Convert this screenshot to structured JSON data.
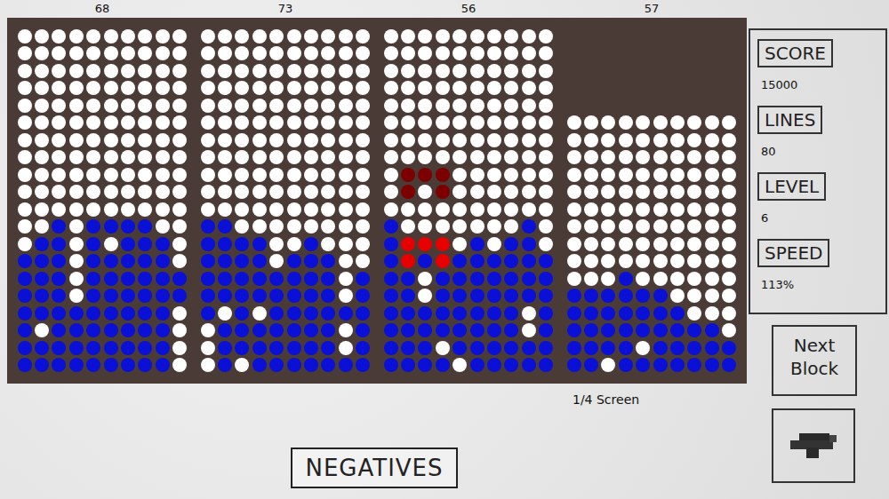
{
  "boards": [
    {
      "score": "68",
      "rows": [
        "wwwwwwwwww",
        "wwwwwwwwww",
        "wwwwwwwwww",
        "wwwwwwwwww",
        "wwwwwwwwww",
        "wwwwwwwwww",
        "wwwwwwwwww",
        "wwwwwwwwww",
        "wwwwwwwwww",
        "wwwwwwwwww",
        "wwwwwwwwww",
        "wwbwbbbbww",
        "wbbwbwbbbw",
        "bbbwbbbbbw",
        "bbbwbbbbbb",
        "bbbwbbbbbb",
        "bbbbbbbbbw",
        "bwbbbbbbbw",
        "bbbbbbbbbw",
        "bbbbbbbbbw"
      ]
    },
    {
      "score": "73",
      "rows": [
        "wwwwwwwwww",
        "wwwwwwwwww",
        "wwwwwwwwww",
        "wwwwwwwwww",
        "wwwwwwwwww",
        "wwwwwwwwww",
        "wwwwwwwwww",
        "wwwwwwwwww",
        "wwwwwwwwww",
        "wwwwwwwwww",
        "wwwwwwwwww",
        "bbwwwwwwww",
        "bbbbwwbwww",
        "bbbbwbbbww",
        "bbbbbbbbwb",
        "bbbbbbbbwb",
        "bwbwbbbbbb",
        "wbbbbbbbwb",
        "wbbbbbbbwb",
        "wbwbbbbbbb"
      ]
    },
    {
      "score": "56",
      "rows": [
        "wwwwwwwwww",
        "wwwwwwwwww",
        "wwwwwwwwww",
        "wwwwwwwwww",
        "wwwwwwwwww",
        "wwwwwwwwww",
        "wwwwwwwwww",
        "wwwwwwwwww",
        "wdddwwwwww",
        "wdwdwwwwww",
        "wwwwwwwwww",
        "bwwwwwwwbw",
        "brrrwbwbbw",
        "brbrbbbbbb",
        "bbwbbbbbbb",
        "bbwbbbbbbb",
        "bbbbbbbbwb",
        "bbbbbbbbwb",
        "bbbwbbbbbb",
        "bbbbwbbbbb"
      ]
    },
    {
      "score": "57",
      "caption": "1/4 Screen",
      "rows": [
        "eeeeeeeeee",
        "eeeeeeeeee",
        "eeeeeeeeee",
        "eeeeeeeeee",
        "eeeeeeeeee",
        "wwwwwwwwww",
        "wwwwwwwwww",
        "wwwwwwwwww",
        "wwwwwwwwww",
        "wwwwwwwwww",
        "wwwwwwwwww",
        "wwwwwwwwww",
        "wwwwwwwwww",
        "wwwwwwwwww",
        "wwwbwwwwww",
        "bbbbbbwwww",
        "bbbbbbbwww",
        "bbbbbbbbbw",
        "bbbbwbbbbb",
        "bbwbbbbbbb"
      ]
    }
  ],
  "stats": [
    {
      "label": "SCORE",
      "value": "15000"
    },
    {
      "label": "LINES",
      "value": "80"
    },
    {
      "label": "LEVEL",
      "value": "6"
    },
    {
      "label": "SPEED",
      "value": "113%"
    }
  ],
  "next_block": {
    "label": "Next Block"
  },
  "mode_button": {
    "label": "NEGATIVES"
  }
}
